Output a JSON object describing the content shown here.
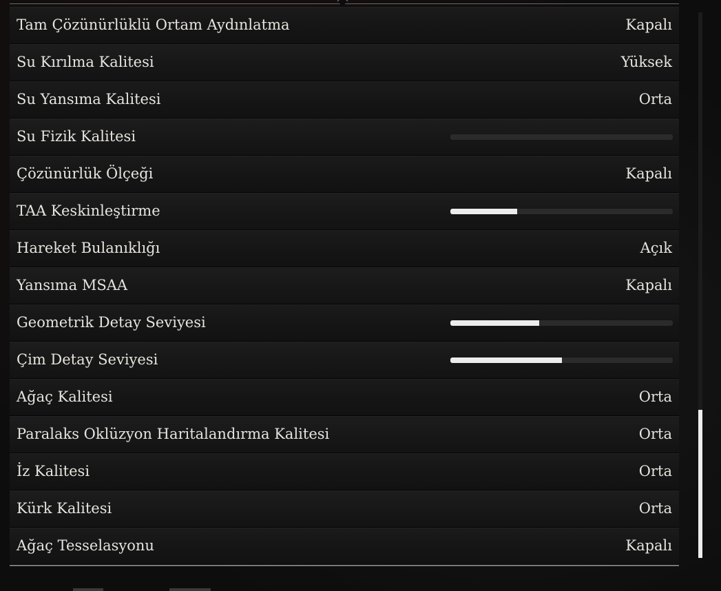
{
  "settings": [
    {
      "label": "Tam Çözünürlüklü Ortam Aydınlatma",
      "type": "option",
      "value": "Kapalı"
    },
    {
      "label": "Su Kırılma Kalitesi",
      "type": "option",
      "value": "Yüksek"
    },
    {
      "label": "Su Yansıma Kalitesi",
      "type": "option",
      "value": "Orta"
    },
    {
      "label": "Su Fizik Kalitesi",
      "type": "slider",
      "level": 0.0
    },
    {
      "label": "Çözünürlük Ölçeği",
      "type": "option",
      "value": "Kapalı"
    },
    {
      "label": "TAA Keskinleştirme",
      "type": "slider",
      "level": 0.3
    },
    {
      "label": "Hareket Bulanıklığı",
      "type": "option",
      "value": "Açık"
    },
    {
      "label": "Yansıma MSAA",
      "type": "option",
      "value": "Kapalı"
    },
    {
      "label": "Geometrik Detay Seviyesi",
      "type": "slider",
      "level": 0.4
    },
    {
      "label": "Çim Detay Seviyesi",
      "type": "slider",
      "level": 0.5
    },
    {
      "label": "Ağaç Kalitesi",
      "type": "option",
      "value": "Orta"
    },
    {
      "label": "Paralaks Oklüzyon Haritalandırma Kalitesi",
      "type": "option",
      "value": "Orta"
    },
    {
      "label": "İz Kalitesi",
      "type": "option",
      "value": "Orta"
    },
    {
      "label": "Kürk Kalitesi",
      "type": "option",
      "value": "Orta"
    },
    {
      "label": "Ağaç Tesselasyonu",
      "type": "option",
      "value": "Kapalı"
    }
  ],
  "scrollbar": {
    "position": 0.72,
    "visible_fraction": 0.27
  },
  "colors": {
    "background": "#0d0d0d",
    "row": "#181818",
    "text": "#e6e4de",
    "slider_fill": "#ededed",
    "slider_track": "#2b2b2b"
  }
}
